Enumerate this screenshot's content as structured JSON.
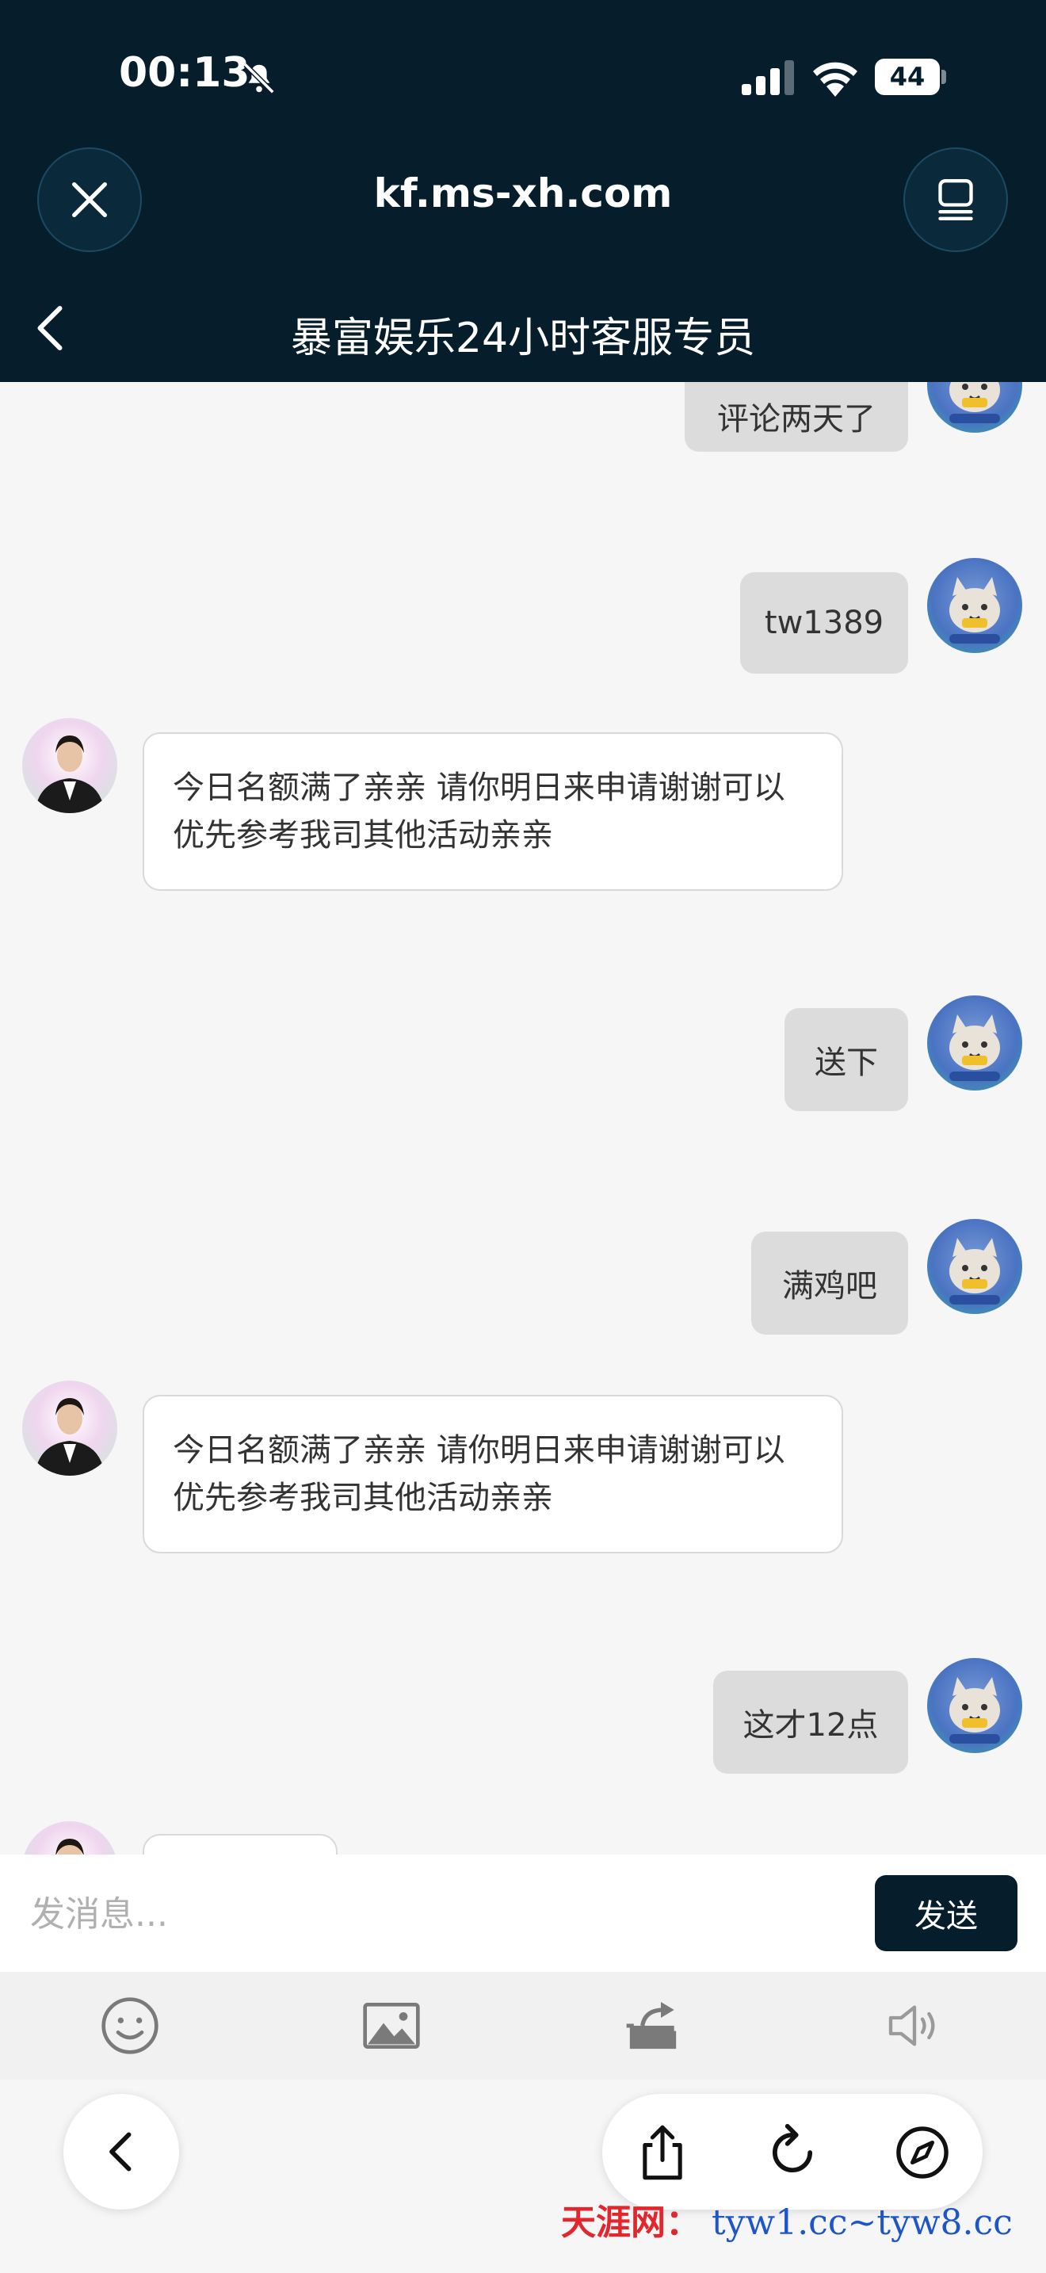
{
  "status_bar": {
    "time": "00:13",
    "battery": "44",
    "icons": [
      "bell-off-icon",
      "signal-icon",
      "wifi-icon",
      "battery-icon"
    ]
  },
  "browser": {
    "url": "kf.ms-xh.com"
  },
  "chat": {
    "title": "暴富娱乐24小时客服专员",
    "messages": [
      {
        "from": "user",
        "text": "评论两天了"
      },
      {
        "from": "user",
        "text": "tw1389"
      },
      {
        "from": "agent",
        "text": "今日名额满了亲亲 请你明日来申请谢谢可以优先参考我司其他活动亲亲"
      },
      {
        "from": "user",
        "text": "送下"
      },
      {
        "from": "user",
        "text": "满鸡吧"
      },
      {
        "from": "agent",
        "text": "今日名额满了亲亲 请你明日来申请谢谢可以优先参考我司其他活动亲亲"
      },
      {
        "from": "user",
        "text": "这才12点"
      }
    ]
  },
  "composer": {
    "placeholder": "发消息...",
    "send_label": "发送"
  },
  "toolbar": {
    "icons": [
      "emoji-icon",
      "image-icon",
      "share-screen-icon",
      "speaker-icon"
    ]
  },
  "browser_bar": {
    "icons": [
      "back-icon",
      "share-icon",
      "reload-icon",
      "compass-icon"
    ]
  },
  "watermark": {
    "site_name": "天涯网：",
    "domains": "tyw1.cc~tyw8.cc"
  },
  "colors": {
    "header_bg": "#061d2b",
    "user_bubble": "#dcdcdc",
    "agent_bubble": "#ffffff",
    "send_button": "#061d2b",
    "watermark_red": "#e2262b",
    "watermark_blue": "#1e56c7"
  }
}
